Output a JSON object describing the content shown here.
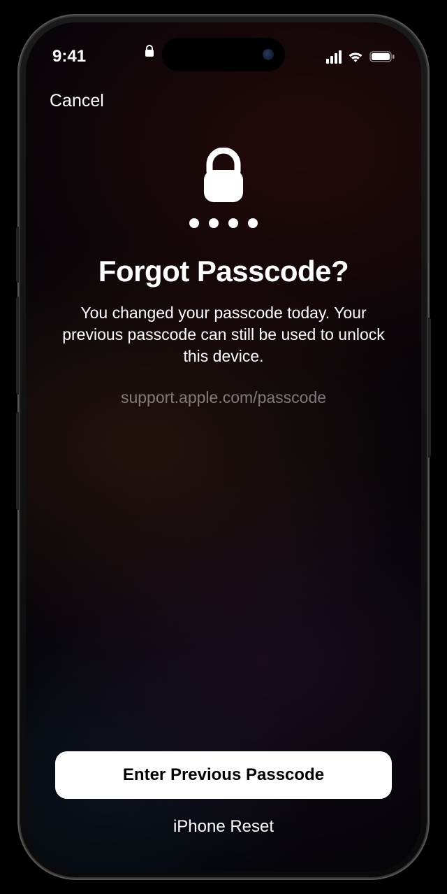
{
  "status_bar": {
    "time": "9:41"
  },
  "nav": {
    "cancel": "Cancel"
  },
  "main": {
    "title": "Forgot Passcode?",
    "description": "You changed your passcode today. Your previous passcode can still be used to unlock this device.",
    "support_link": "support.apple.com/passcode"
  },
  "actions": {
    "primary": "Enter Previous Passcode",
    "secondary": "iPhone Reset"
  }
}
